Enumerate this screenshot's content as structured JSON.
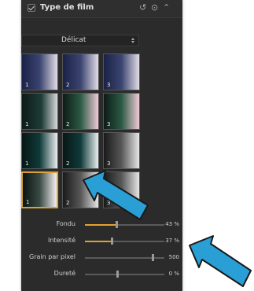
{
  "panel": {
    "title": "Type de film",
    "header_icons": [
      "reset-icon",
      "settings-icon",
      "chevron-up-icon"
    ],
    "dropdown": {
      "selected": "Délicat"
    }
  },
  "presets": [
    {
      "num": "1",
      "style": "t-navy",
      "selected": false
    },
    {
      "num": "2",
      "style": "t-navy",
      "selected": false
    },
    {
      "num": "3",
      "style": "t-navy",
      "selected": false
    },
    {
      "num": "1",
      "style": "t-teal",
      "selected": false
    },
    {
      "num": "2",
      "style": "t-green-pink",
      "selected": false
    },
    {
      "num": "3",
      "style": "t-green-pink",
      "selected": false
    },
    {
      "num": "1",
      "style": "t-dark-cyan",
      "selected": false
    },
    {
      "num": "2",
      "style": "t-dark-cyan",
      "selected": false
    },
    {
      "num": "3",
      "style": "t-gray",
      "selected": false
    },
    {
      "num": "1",
      "style": "t-neutral",
      "selected": true
    },
    {
      "num": "2",
      "style": "t-gray",
      "selected": false
    },
    {
      "num": "3",
      "style": "t-gray",
      "selected": false
    }
  ],
  "sliders": [
    {
      "label": "Fondu",
      "value": "43 %",
      "level": 0.43,
      "fill": true
    },
    {
      "label": "Intensité",
      "value": "37 %",
      "level": 0.37,
      "fill": true
    },
    {
      "label": "Grain par pixel",
      "value": "500",
      "level": 0.93,
      "fill": false
    },
    {
      "label": "Dureté",
      "value": "0 %",
      "level": 0.45,
      "fill": false
    }
  ],
  "colors": {
    "accent": "#e0a32e",
    "annotation_arrow": "#2a9fd6",
    "panel_bg": "#2b2b2b"
  }
}
